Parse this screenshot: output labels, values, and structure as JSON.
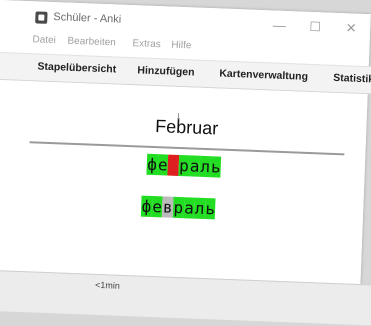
{
  "window": {
    "title": "Schüler - Anki"
  },
  "menu": [
    "Datei",
    "Bearbeiten",
    "Extras",
    "Hilfe"
  ],
  "toolbar": [
    "Stapelübersicht",
    "Hinzufügen",
    "Kartenverwaltung",
    "Statistik"
  ],
  "card": {
    "title": "Februar",
    "typed": [
      {
        "char": "ф",
        "status": "ok"
      },
      {
        "char": "е",
        "status": "ok"
      },
      {
        "char": "",
        "status": "bad"
      },
      {
        "char": "р",
        "status": "ok"
      },
      {
        "char": "а",
        "status": "ok"
      },
      {
        "char": "л",
        "status": "ok"
      },
      {
        "char": "ь",
        "status": "ok"
      }
    ],
    "arrow": "↓",
    "correct": [
      {
        "char": "ф",
        "status": "ok"
      },
      {
        "char": "е",
        "status": "ok"
      },
      {
        "char": "в",
        "status": "miss"
      },
      {
        "char": "р",
        "status": "ok"
      },
      {
        "char": "а",
        "status": "ok"
      },
      {
        "char": "л",
        "status": "ok"
      },
      {
        "char": "ь",
        "status": "ok"
      }
    ]
  },
  "bottom": {
    "interval_label": "<1min"
  },
  "colors": {
    "correct": "#22dd22",
    "wrong": "#dd1f1f",
    "missing": "#bbbbbb"
  }
}
